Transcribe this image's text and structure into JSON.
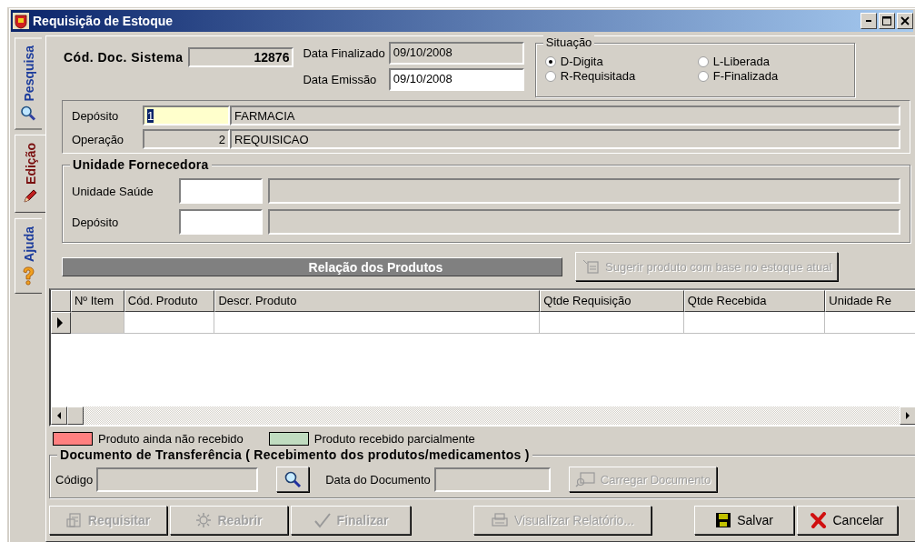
{
  "window": {
    "title": "Requisição de Estoque"
  },
  "side_tabs": [
    {
      "label": "Pesquisa",
      "kind": "search",
      "selected": false
    },
    {
      "label": "Edição",
      "kind": "edit",
      "selected": true
    },
    {
      "label": "Ajuda",
      "kind": "help",
      "selected": false
    }
  ],
  "header": {
    "doc_code": {
      "label": "Cód. Doc. Sistema",
      "value": "12876"
    },
    "date_finalized": {
      "label": "Data Finalizado",
      "value": "09/10/2008"
    },
    "date_issued": {
      "label": "Data Emissão",
      "value": "09/10/2008"
    }
  },
  "situacao": {
    "title": "Situação",
    "options": [
      {
        "label": "D-Digita",
        "selected": true
      },
      {
        "label": "L-Liberada",
        "selected": false
      },
      {
        "label": "R-Requisitada",
        "selected": false
      },
      {
        "label": "F-Finalizada",
        "selected": false
      }
    ]
  },
  "deposit_panel": [
    {
      "label": "Depósito",
      "code": "1",
      "name": "FARMACIA",
      "editable": true,
      "highlighted": true
    },
    {
      "label": "Operação",
      "code": "2",
      "name": "REQUISICAO",
      "editable": false,
      "highlighted": false
    }
  ],
  "supplier": {
    "title": "Unidade Fornecedora",
    "rows": [
      {
        "label": "Unidade Saúde"
      },
      {
        "label": "Depósito"
      }
    ]
  },
  "products": {
    "title": "Relação dos Produtos",
    "suggest_button": {
      "label": "Sugerir produto com base no estoque atual",
      "disabled": true
    },
    "columns": [
      "Nº Item",
      "Cód. Produto",
      "Descr. Produto",
      "Qtde Requisição",
      "Qtde Recebida",
      "Unidade Re"
    ],
    "rows": [
      {
        "current": true
      }
    ]
  },
  "legend": [
    {
      "label": "Produto ainda não recebido",
      "color": "#ff8080"
    },
    {
      "label": "Produto recebido parcialmente",
      "color": "#c0dcc0"
    }
  ],
  "transfer": {
    "title": "Documento de Transferência ( Recebimento dos produtos/medicamentos )",
    "code_label": "Código",
    "date_label": "Data do Documento",
    "load_button": {
      "label": "Carregar Documento",
      "disabled": true
    }
  },
  "buttons": [
    {
      "label": "Requisitar",
      "kind": "request",
      "disabled": true
    },
    {
      "label": "Reabrir",
      "kind": "reopen",
      "disabled": true
    },
    {
      "label": "Finalizar",
      "kind": "finish",
      "disabled": true
    },
    {
      "label": "Visualizar Relatório...",
      "kind": "report",
      "disabled": true
    },
    {
      "label": "Salvar",
      "kind": "save",
      "disabled": false
    },
    {
      "label": "Cancelar",
      "kind": "cancel",
      "disabled": false
    }
  ]
}
